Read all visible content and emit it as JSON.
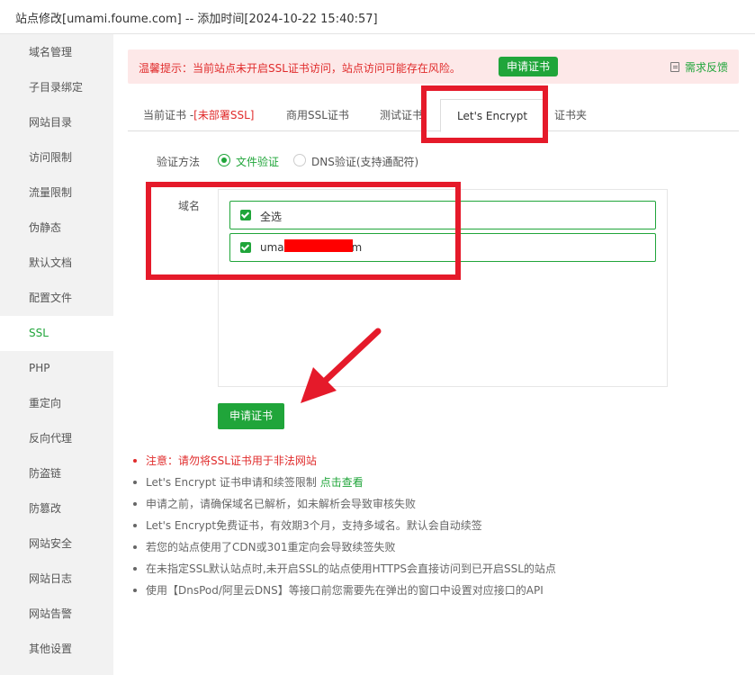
{
  "window": {
    "title": "站点修改[umami.foume.com] -- 添加时间[2024-10-22 15:40:57]"
  },
  "sidebar": {
    "items": [
      {
        "label": "域名管理"
      },
      {
        "label": "子目录绑定"
      },
      {
        "label": "网站目录"
      },
      {
        "label": "访问限制"
      },
      {
        "label": "流量限制"
      },
      {
        "label": "伪静态"
      },
      {
        "label": "默认文档"
      },
      {
        "label": "配置文件"
      },
      {
        "label": "SSL",
        "active": true
      },
      {
        "label": "PHP"
      },
      {
        "label": "重定向"
      },
      {
        "label": "反向代理"
      },
      {
        "label": "防盗链"
      },
      {
        "label": "防篡改"
      },
      {
        "label": "网站安全"
      },
      {
        "label": "网站日志"
      },
      {
        "label": "网站告警"
      },
      {
        "label": "其他设置"
      }
    ]
  },
  "alert": {
    "message": "温馨提示：当前站点未开启SSL证书访问，站点访问可能存在风险。",
    "apply_button": "申请证书",
    "feedback": "需求反馈"
  },
  "tabs": {
    "current_cert": "当前证书 -",
    "current_cert_status": "[未部署SSL]",
    "commercial": "商用SSL证书",
    "test": "测试证书",
    "letsencrypt": "Let's Encrypt",
    "cert_folder": "证书夹",
    "active": "Let's Encrypt"
  },
  "verify": {
    "label": "验证方法",
    "options": [
      {
        "label": "文件验证",
        "selected": true
      },
      {
        "label": "DNS验证(支持通配符)",
        "selected": false
      }
    ]
  },
  "domains": {
    "label": "域名",
    "items": [
      {
        "label": "全选",
        "checked": true
      },
      {
        "label": "umami.foume.com",
        "checked": true
      }
    ]
  },
  "submit_button": "申请证书",
  "notes": [
    {
      "text": "注意：请勿将SSL证书用于非法网站",
      "style": "red"
    },
    {
      "text": "Let's Encrypt 证书申请和续签限制 ",
      "link": "点击查看"
    },
    {
      "text": "申请之前，请确保域名已解析，如未解析会导致审核失败"
    },
    {
      "text": "Let's Encrypt免费证书，有效期3个月，支持多域名。默认会自动续签"
    },
    {
      "text": "若您的站点使用了CDN或301重定向会导致续签失败"
    },
    {
      "text": "在未指定SSL默认站点时,未开启SSL的站点使用HTTPS会直接访问到已开启SSL的站点"
    },
    {
      "text": "使用【DnsPod/阿里云DNS】等接口前您需要先在弹出的窗口中设置对应接口的API"
    }
  ],
  "colors": {
    "accent": "#20a53a",
    "danger": "#e02b2b",
    "alert_bg": "#fde8e8",
    "annotation": "#e51a2a",
    "sidebar_bg": "#f2f2f2"
  }
}
